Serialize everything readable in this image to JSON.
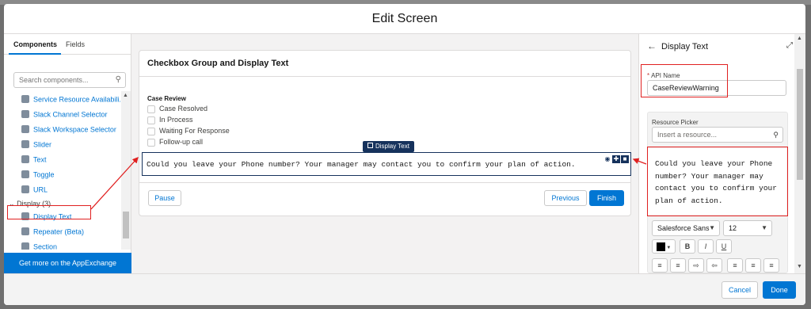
{
  "modal": {
    "title": "Edit Screen"
  },
  "left_panel": {
    "tabs": [
      {
        "label": "Components"
      },
      {
        "label": "Fields"
      }
    ],
    "search_placeholder": "Search components...",
    "items": [
      {
        "label": "Service Resource Availabili..."
      },
      {
        "label": "Slack Channel Selector"
      },
      {
        "label": "Slack Workspace Selector"
      },
      {
        "label": "Slider"
      },
      {
        "label": "Text"
      },
      {
        "label": "Toggle"
      },
      {
        "label": "URL"
      }
    ],
    "display_section": "Display (3)",
    "display_items": [
      {
        "label": "Display Text"
      },
      {
        "label": "Repeater (Beta)"
      },
      {
        "label": "Section"
      }
    ],
    "appexchange_label": "Get more on the AppExchange"
  },
  "canvas": {
    "card_title": "Checkbox Group and Display Text",
    "checkbox_group_label": "Case Review",
    "checkbox_options": [
      "Case Resolved",
      "In Process",
      "Waiting For Response",
      "Follow-up call"
    ],
    "display_text_badge": "Display Text",
    "display_text_content": "Could you leave your Phone number? Your manager may contact you to confirm your plan of action.",
    "pause_label": "Pause",
    "previous_label": "Previous",
    "finish_label": "Finish"
  },
  "right_panel": {
    "title": "Display Text",
    "api_name_label": "API Name",
    "api_name_value": "CaseReviewWarning",
    "resource_picker_label": "Resource Picker",
    "resource_placeholder": "Insert a resource...",
    "rte_content": "Could you leave your Phone number? Your manager may contact you to confirm your plan of action.",
    "font_family": "Salesforce Sans",
    "font_size": "12",
    "bold_label": "B",
    "italic_label": "I",
    "underline_label": "U"
  },
  "footer": {
    "cancel_label": "Cancel",
    "done_label": "Done"
  },
  "colors": {
    "brand": "#0176d3",
    "navy": "#16325c",
    "highlight": "#e02020"
  }
}
